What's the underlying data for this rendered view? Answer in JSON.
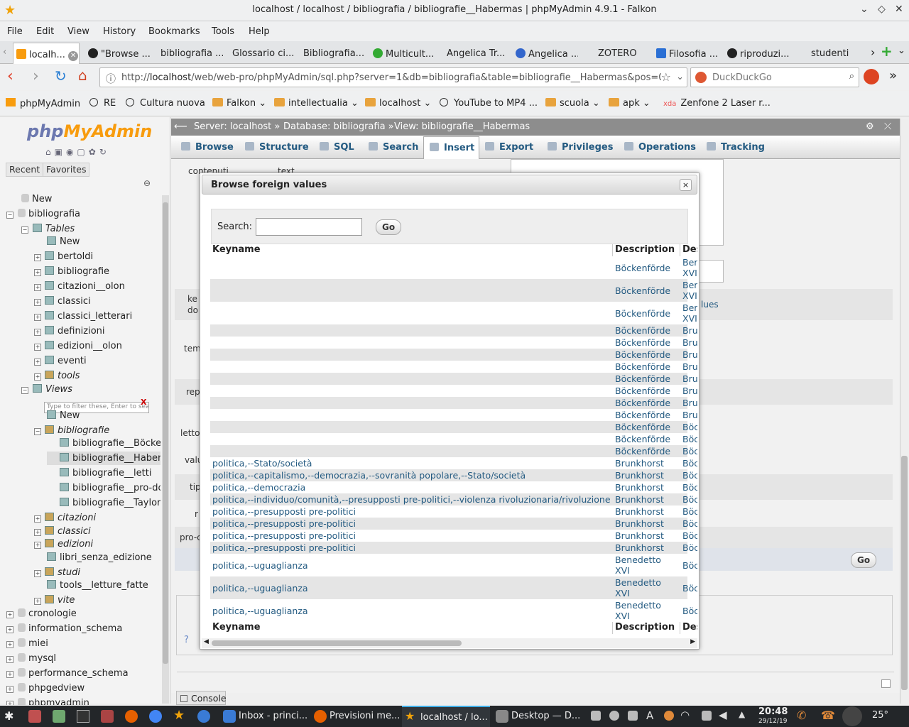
{
  "window": {
    "title": "localhost / localhost / bibliografia / bibliografie__Habermas | phpMyAdmin 4.9.1 - Falkon"
  },
  "menu": [
    "File",
    "Edit",
    "View",
    "History",
    "Bookmarks",
    "Tools",
    "Help"
  ],
  "tabs": [
    "localh...",
    "\"Browse ...",
    "bibliografia ...",
    "Glossario ci...",
    "Bibliografia...",
    "Multicult...",
    "Angelica Tr...",
    "Angelica ...",
    "ZOTERO",
    "Filosofia ...",
    "riproduzi...",
    "studenti"
  ],
  "nav": {
    "url_prefix": "http://",
    "url_host": "localhost",
    "url_rest": "/web/web-pro/phpMyAdmin/sql.php?server=1&db=bibliografia&table=bibliografie__Habermas&pos=0",
    "search_placeholder": "DuckDuckGo"
  },
  "bookmarks": [
    "phpMyAdmin",
    "RE",
    "Cultura nuova",
    "Falkon",
    "intellectualia",
    "localhost",
    "YouTube to MP4 ...",
    "scuola",
    "apk",
    "Zenfone 2 Laser r..."
  ],
  "pma": {
    "logo_a": "php",
    "logo_b": "MyAdmin",
    "recent": "Recent",
    "favorites": "Favorites",
    "tree": {
      "new": "New",
      "bibliografia": "bibliografia",
      "tables": "Tables",
      "tables_new": "New",
      "tables_list": [
        "bertoldi",
        "bibliografie",
        "citazioni__olon",
        "classici",
        "classici_letterari",
        "definizioni",
        "edizioni__olon",
        "eventi"
      ],
      "tools": "tools",
      "views": "Views",
      "filter_placeholder": "Type to filter these, Enter to search",
      "views_new": "New",
      "view_group": "bibliografie",
      "view_items": [
        "bibliografie__Böckenf",
        "bibliografie__Haberm",
        "bibliografie__letti",
        "bibliografie__pro-doct",
        "bibliografie__Taylor"
      ],
      "view_groups2": [
        "citazioni",
        "classici",
        "edizioni"
      ],
      "libri": "libri_senza_edizione",
      "studi": "studi",
      "tools_lf": "tools__letture_fatte",
      "vite": "vite",
      "dbs": [
        "cronologie",
        "information_schema",
        "miei",
        "mysql",
        "performance_schema",
        "phpgedview",
        "phpmyadmin"
      ]
    },
    "breadcrumb": {
      "server": "Server: localhost »",
      "db": "Database: bibliografia »",
      "view": "View: bibliografie__Habermas"
    },
    "tabs": [
      "Browse",
      "Structure",
      "SQL",
      "Search",
      "Insert",
      "Export",
      "Privileges",
      "Operations",
      "Tracking"
    ],
    "bg_labels": [
      "contenuti",
      "text",
      "ke",
      "do",
      "tem",
      "rep",
      "letto",
      "valu",
      "tip",
      "r",
      "pro-c"
    ],
    "bg_lues": "lues",
    "bg_go": "Go",
    "console": "Console"
  },
  "modal": {
    "title": "Browse foreign values",
    "close": "×",
    "search_label": "Search:",
    "go": "Go",
    "headers": {
      "key": "Keyname",
      "desc": "Description",
      "desc2": "Des"
    },
    "rows": [
      {
        "key": "",
        "desc": "Böckenförde",
        "d2": "Ber XVI"
      },
      {
        "key": "",
        "desc": "Böckenförde",
        "d2": "Ber XVI"
      },
      {
        "key": "",
        "desc": "Böckenförde",
        "d2": "Ber XVI"
      },
      {
        "key": "",
        "desc": "Böckenförde",
        "d2": "Bru"
      },
      {
        "key": "",
        "desc": "Böckenförde",
        "d2": "Bru"
      },
      {
        "key": "",
        "desc": "Böckenförde",
        "d2": "Bru"
      },
      {
        "key": "",
        "desc": "Böckenförde",
        "d2": "Bru"
      },
      {
        "key": "",
        "desc": "Böckenförde",
        "d2": "Bru"
      },
      {
        "key": "",
        "desc": "Böckenförde",
        "d2": "Bru"
      },
      {
        "key": "",
        "desc": "Böckenförde",
        "d2": "Bru"
      },
      {
        "key": "",
        "desc": "Böckenförde",
        "d2": "Bru"
      },
      {
        "key": "",
        "desc": "Böckenförde",
        "d2": "Böc"
      },
      {
        "key": "",
        "desc": "Böckenförde",
        "d2": "Böc"
      },
      {
        "key": "",
        "desc": "Böckenförde",
        "d2": "Böc"
      },
      {
        "key": "politica,--Stato/società",
        "desc": "Brunkhorst",
        "d2": "Böc"
      },
      {
        "key": "politica,--capitalismo,--democrazia,--sovranità popolare,--Stato/società",
        "desc": "Brunkhorst",
        "d2": "Böc"
      },
      {
        "key": "politica,--democrazia",
        "desc": "Brunkhorst",
        "d2": "Böc"
      },
      {
        "key": "politica,--individuo/comunità,--presupposti pre-politici,--violenza rivoluzionaria/rivoluzione",
        "desc": "Brunkhorst",
        "d2": "Böc"
      },
      {
        "key": "politica,--presupposti pre-politici",
        "desc": "Brunkhorst",
        "d2": "Böc"
      },
      {
        "key": "politica,--presupposti pre-politici",
        "desc": "Brunkhorst",
        "d2": "Böc"
      },
      {
        "key": "politica,--presupposti pre-politici",
        "desc": "Brunkhorst",
        "d2": "Böc"
      },
      {
        "key": "politica,--presupposti pre-politici",
        "desc": "Brunkhorst",
        "d2": "Böc"
      },
      {
        "key": "politica,--uguaglianza",
        "desc": "Benedetto XVI",
        "d2": "Böc"
      },
      {
        "key": "politica,--uguaglianza",
        "desc": "Benedetto XVI",
        "d2": "Böc"
      },
      {
        "key": "politica,--uguaglianza",
        "desc": "Benedetto XVI",
        "d2": "Böc"
      }
    ]
  },
  "taskbar": {
    "items": [
      "Inbox - princi...",
      "Previsioni me...",
      "localhost / lo...",
      "Desktop — D..."
    ],
    "time": "20:48",
    "date": "29/12/19",
    "temp": "25°"
  }
}
